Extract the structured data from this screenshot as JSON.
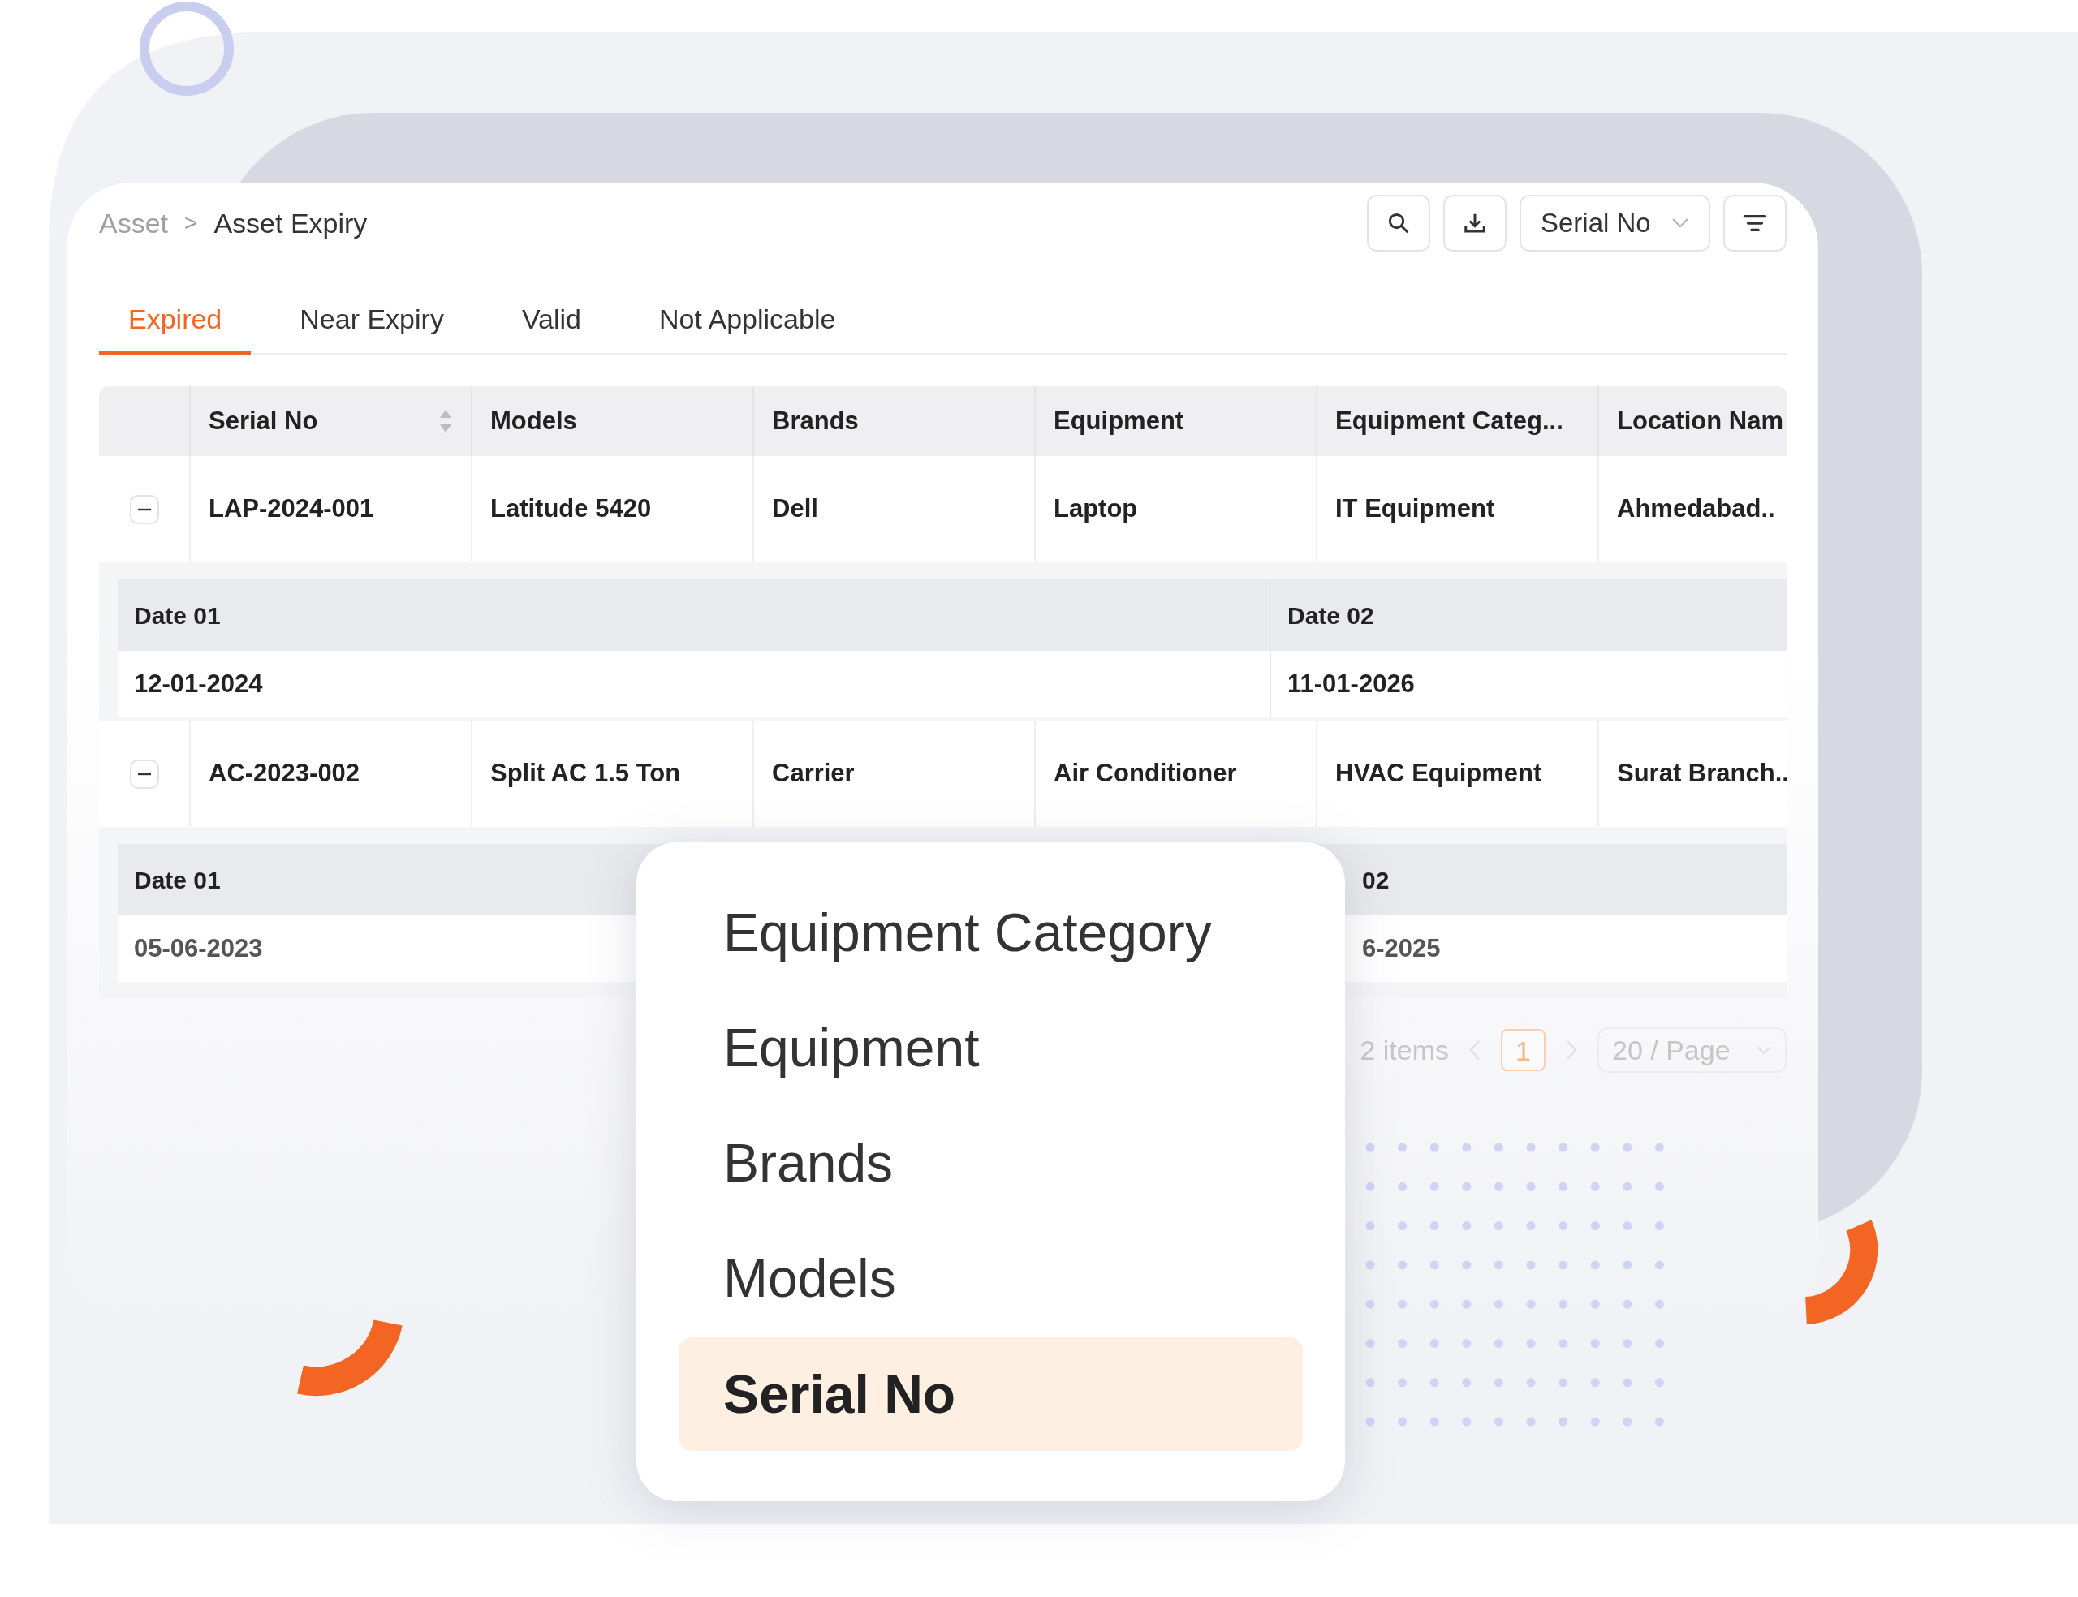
{
  "breadcrumb": {
    "items": [
      {
        "label": "Asset",
        "current": false
      },
      {
        "label": "Asset Expiry",
        "current": true
      }
    ],
    "separator": ">"
  },
  "toolbar": {
    "sort_select": {
      "value": "Serial No"
    }
  },
  "tabs": [
    {
      "label": "Expired",
      "selected": true
    },
    {
      "label": "Near Expiry",
      "selected": false
    },
    {
      "label": "Valid",
      "selected": false
    },
    {
      "label": "Not Applicable",
      "selected": false
    }
  ],
  "table": {
    "columns": [
      {
        "label": "Serial No",
        "sortable": true
      },
      {
        "label": "Models",
        "sortable": false
      },
      {
        "label": "Brands",
        "sortable": false
      },
      {
        "label": "Equipment",
        "sortable": false
      },
      {
        "label": "Equipment Categ...",
        "sortable": false
      },
      {
        "label": "Location Nam"
      }
    ],
    "rows": [
      {
        "expanded": true,
        "cells": [
          "LAP-2024-001",
          "Latitude 5420",
          "Dell",
          "Laptop",
          "IT Equipment",
          "Ahmedabad.."
        ],
        "details": [
          {
            "label": "Date 01",
            "value": "12-01-2024"
          },
          {
            "label": "Date 02",
            "value": "11-01-2026"
          }
        ]
      },
      {
        "expanded": true,
        "cells": [
          "AC-2023-002",
          "Split AC 1.5 Ton",
          "Carrier",
          "Air Conditioner",
          "HVAC Equipment",
          "Surat Branch.."
        ],
        "details": [
          {
            "label": "Date 01",
            "value": "05-06-2023"
          },
          {
            "label": "02",
            "value": "6-2025"
          }
        ]
      }
    ]
  },
  "pagination": {
    "total": "2 items",
    "pages": [
      {
        "label": "1",
        "selected": true
      }
    ],
    "page_size": "20 / Page"
  },
  "dropdown": {
    "options": [
      {
        "label": "Equipment Category",
        "selected": false
      },
      {
        "label": "Equipment",
        "selected": false
      },
      {
        "label": "Brands",
        "selected": false
      },
      {
        "label": "Models",
        "selected": false
      },
      {
        "label": "Serial No",
        "selected": true
      }
    ]
  }
}
